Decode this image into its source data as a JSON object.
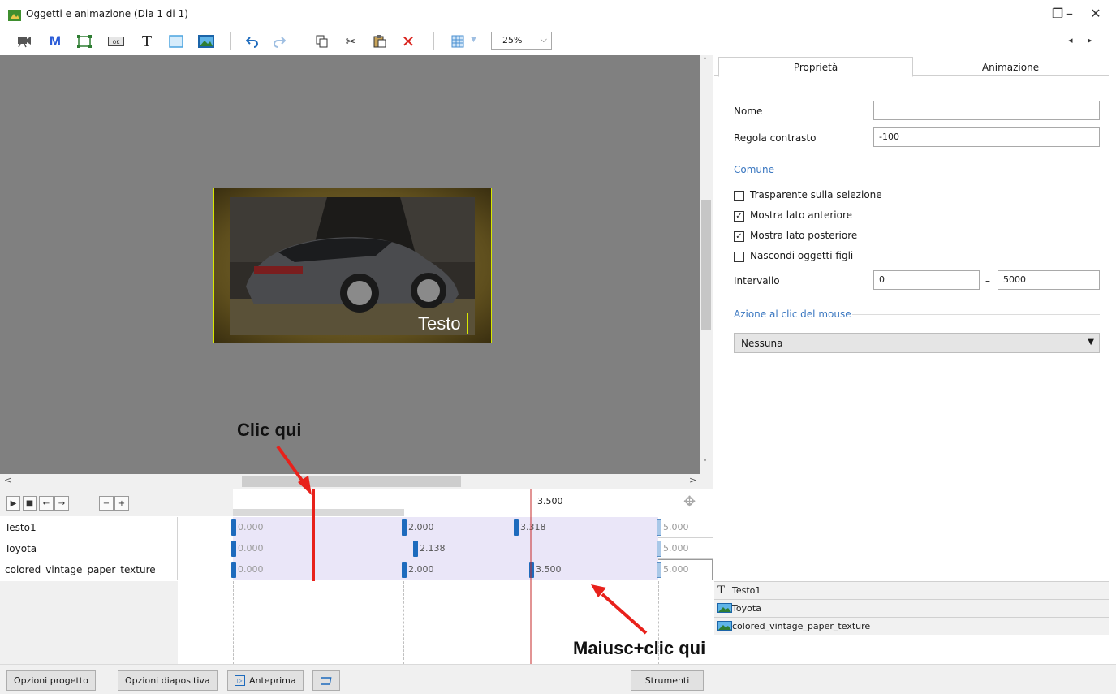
{
  "window": {
    "title": "Oggetti e animazione (Dia 1 di 1)",
    "minimize": "–",
    "restore": "❐",
    "close": "✕"
  },
  "toolbar": {
    "icons": [
      "camera-icon",
      "mask-icon",
      "frame-icon",
      "button-icon",
      "text-icon",
      "rectangle-icon",
      "image-icon",
      "undo-icon",
      "redo-icon",
      "copy-icon",
      "cut-icon",
      "paste-icon",
      "delete-icon",
      "grid-icon"
    ],
    "zoom_value": "25%",
    "nav_left": "◂",
    "nav_right": "▸"
  },
  "canvas": {
    "text_object": "Testo"
  },
  "annotations": {
    "click_here": "Clic qui",
    "shift_click_here": "Maiusc+clic qui",
    "arrow_color": "#e8211b"
  },
  "timeline": {
    "cursor_time": "3.500",
    "rows": [
      {
        "name": "Testo1",
        "keyframes": [
          "0.000",
          "2.000",
          "3.318",
          "5.000"
        ]
      },
      {
        "name": "Toyota",
        "keyframes": [
          "0.000",
          "2.138",
          "5.000"
        ]
      },
      {
        "name": "colored_vintage_paper_texture",
        "keyframes": [
          "0.000",
          "2.000",
          "3.500",
          "5.000"
        ]
      }
    ]
  },
  "properties": {
    "tabs": [
      "Proprietà",
      "Animazione"
    ],
    "name_label": "Nome",
    "name_value": "",
    "contrast_label": "Regola contrasto",
    "contrast_value": "-100",
    "common_section": "Comune",
    "checkboxes": [
      {
        "label": "Trasparente sulla selezione",
        "checked": false
      },
      {
        "label": "Mostra lato anteriore",
        "checked": true
      },
      {
        "label": "Mostra lato posteriore",
        "checked": true
      },
      {
        "label": "Nascondi oggetti figli",
        "checked": false
      }
    ],
    "interval_label": "Intervallo",
    "interval_from": "0",
    "interval_dash": "–",
    "interval_to": "5000",
    "mouse_section": "Azione al clic del mouse",
    "mouse_action": "Nessuna"
  },
  "object_list": [
    "Testo1",
    "Toyota",
    "colored_vintage_paper_texture"
  ],
  "bottom": {
    "project_options": "Opzioni progetto",
    "slide_options": "Opzioni diapositiva",
    "preview": "Anteprima",
    "tools": "Strumenti"
  }
}
